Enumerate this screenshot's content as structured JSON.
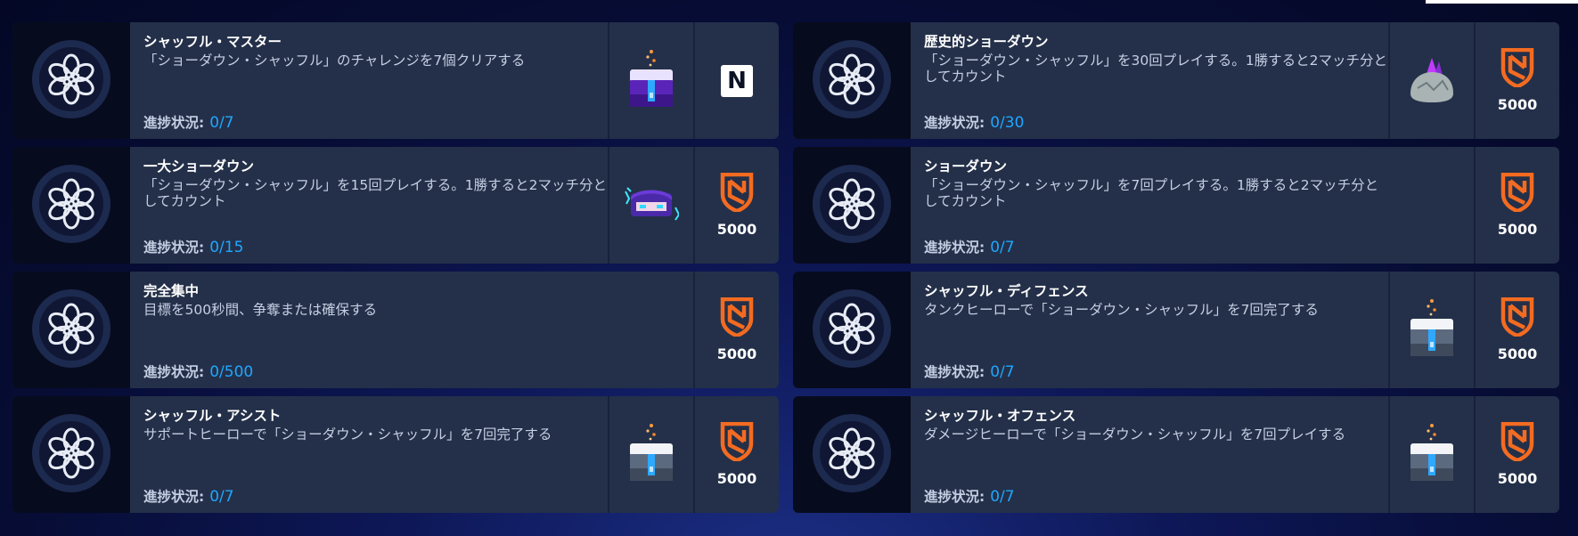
{
  "progress_label": "進捗状況:",
  "reward_amount": "5000",
  "n_logo_letter": "N",
  "colors": {
    "card_bg": "#243049",
    "icon_panel": "#070b1e",
    "progress_value": "#1fa7ff",
    "currency": "#f36b21"
  },
  "challenges": [
    {
      "title": "シャッフル・マスター",
      "desc": "「ショーダウン・シャッフル」のチャレンジを7個クリアする",
      "progress": "0/7",
      "reward_item": "purple-loot-box-icon",
      "reward_currency": "n-logo-icon"
    },
    {
      "title": "歴史的ショーダウン",
      "desc": "「ショーダウン・シャッフル」を30回プレイする。1勝すると2マッチ分としてカウント",
      "progress": "0/30",
      "reward_item": "crystal-rock-icon",
      "reward_currency": "shield-currency-icon"
    },
    {
      "title": "一大ショーダウン",
      "desc": "「ショーダウン・シャッフル」を15回プレイする。1勝すると2マッチ分としてカウント",
      "progress": "0/15",
      "reward_item": "hero-spray-icon",
      "reward_currency": "shield-currency-icon"
    },
    {
      "title": "ショーダウン",
      "desc": "「ショーダウン・シャッフル」を7回プレイする。1勝すると2マッチ分としてカウント",
      "progress": "0/7",
      "reward_item": "",
      "reward_currency": "shield-currency-icon"
    },
    {
      "title": "完全集中",
      "desc": "目標を500秒間、争奪または確保する",
      "progress": "0/500",
      "reward_item": "",
      "reward_currency": "shield-currency-icon"
    },
    {
      "title": "シャッフル・ディフェンス",
      "desc": "タンクヒーローで「ショーダウン・シャッフル」を7回完了する",
      "progress": "0/7",
      "reward_item": "white-loot-box-icon",
      "reward_currency": "shield-currency-icon"
    },
    {
      "title": "シャッフル・アシスト",
      "desc": "サポートヒーローで「ショーダウン・シャッフル」を7回完了する",
      "progress": "0/7",
      "reward_item": "white-loot-box-icon",
      "reward_currency": "shield-currency-icon"
    },
    {
      "title": "シャッフル・オフェンス",
      "desc": "ダメージヒーローで「ショーダウン・シャッフル」を7回プレイする",
      "progress": "0/7",
      "reward_item": "white-loot-box-icon",
      "reward_currency": "shield-currency-icon"
    }
  ]
}
